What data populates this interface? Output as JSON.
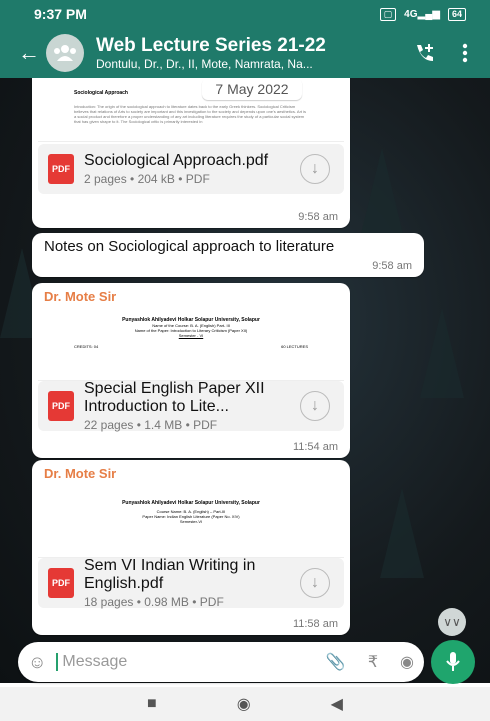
{
  "status": {
    "time": "9:37 PM",
    "signal": "4G",
    "battery": "64"
  },
  "header": {
    "title": "Web Lecture Series 21-22",
    "subtitle": "Dontulu, Dr., Dr., II, Mote, Namrata, Na..."
  },
  "messages": {
    "date_chip": "7 May 2022",
    "doc1": {
      "name": "Sociological Approach.pdf",
      "meta": "2 pages • 204 kB • PDF",
      "time": "9:58 am",
      "preview_heading": "Sociological Approach",
      "preview_intro": "Introduction: The origin of the sociological approach to literature dates back to the early Greek thinkers. Sociological Criticism believes that relations of Arts to society are important and this investigation to the society and depends upon one's aesthetics. Art is a social product and therefore a proper understanding of any art including literature requires the study of a particular social system that has given shape to it. The Sociological critic is primarily interested in"
    },
    "text1": {
      "body": "Notes on Sociological approach to literature",
      "time": "9:58 am"
    },
    "doc2": {
      "sender": "Dr. Mote Sir",
      "name": "Special English Paper XII Introduction to Lite...",
      "meta": "22 pages • 1.4 MB • PDF",
      "time": "11:54 am",
      "preview_title": "Punyashlok Ahilyadevi Holkar Solapur University, Solapur",
      "preview_line2": "Name of the Course: B. A. (English) Part- III",
      "preview_line3": "Name of the Paper: Introduction to Literary Criticism (Paper XII)",
      "preview_line4": "Semester - VI",
      "preview_left": "CREDITS: 04",
      "preview_right": "60 LECTURES"
    },
    "doc3": {
      "sender": "Dr. Mote Sir",
      "name": "Sem VI Indian Writing in English.pdf",
      "meta": "18 pages • 0.98 MB • PDF",
      "time": "11:58 am",
      "preview_title": "Punyashlok Ahilyadevi Holkar Solapur University, Solapur",
      "preview_line2": "Course Name: B. A. (English) – Part-III",
      "preview_line3": "Paper Name: Indian English Literature (Paper No. XIV)",
      "preview_line4": "Semester-VI"
    }
  },
  "composer": {
    "placeholder": "Message"
  },
  "colors": {
    "header": "#1f7a6a",
    "mic": "#1fa56d",
    "sender": "#e67e46",
    "pdf": "#e53935"
  }
}
